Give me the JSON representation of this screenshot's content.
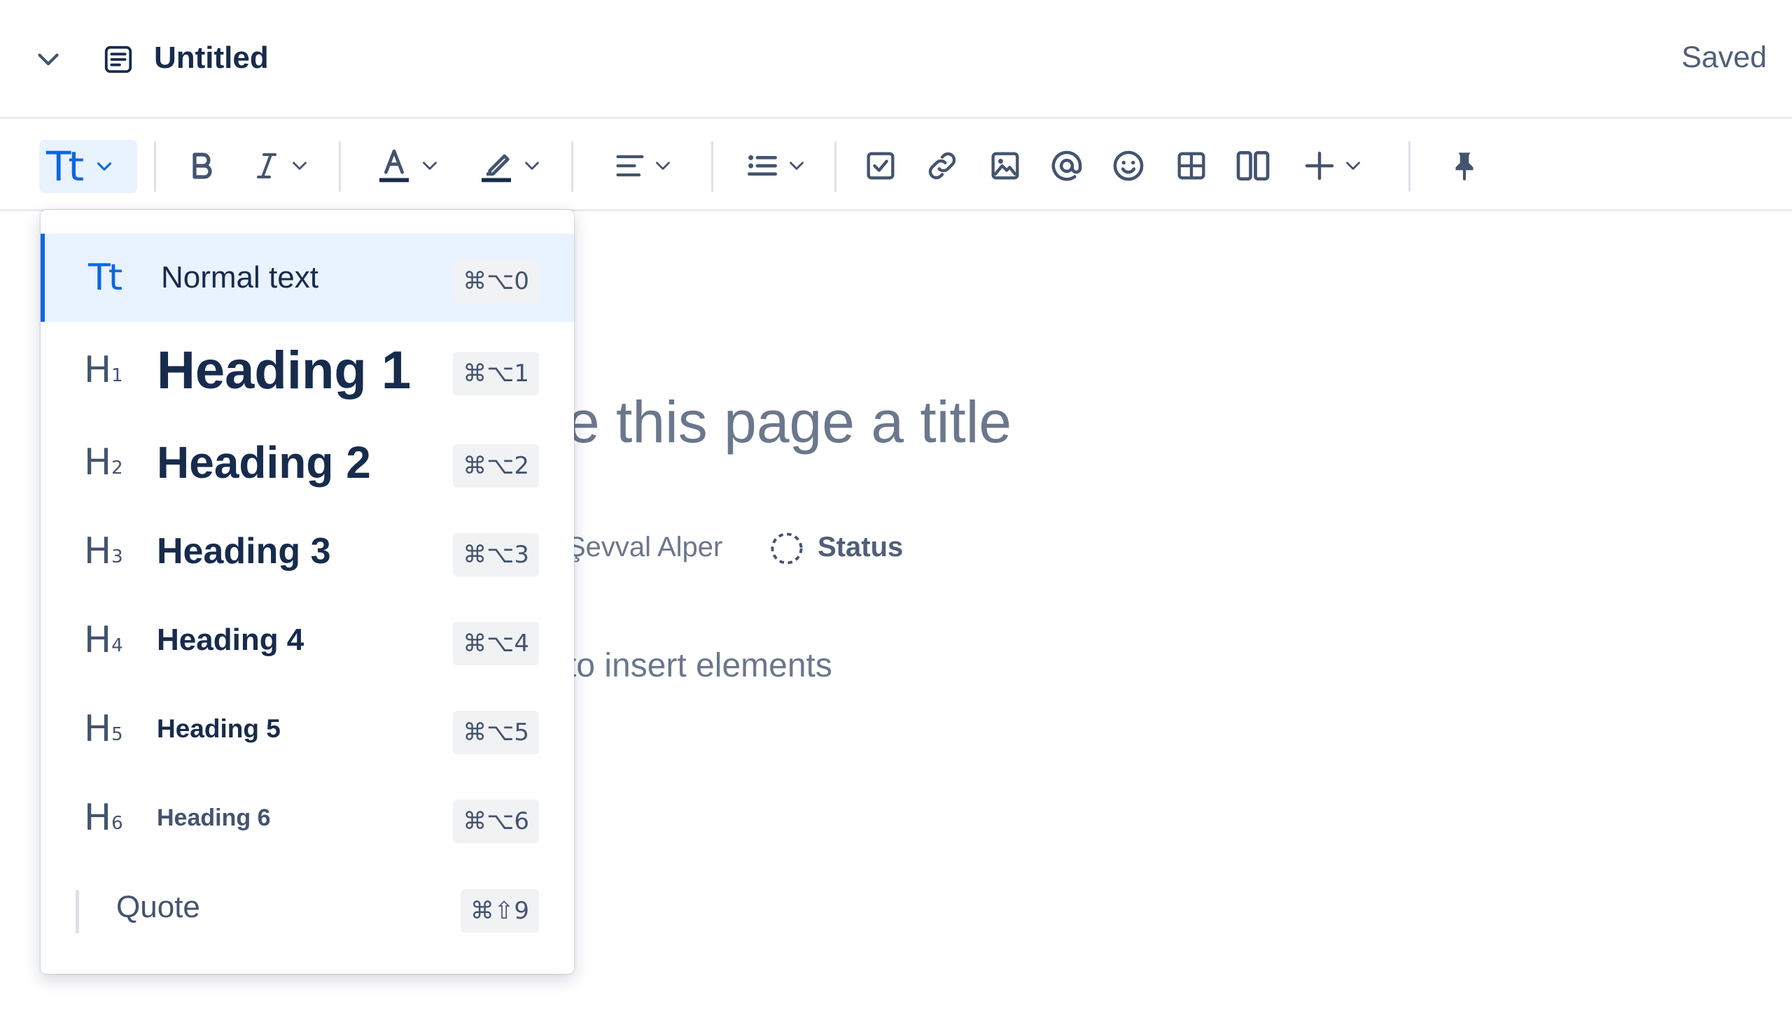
{
  "header": {
    "title": "Untitled",
    "status": "Saved",
    "icons": {
      "collapse": "chevron-down-icon",
      "page": "page-icon"
    }
  },
  "toolbar": {
    "text_style_glyph": "Tt",
    "items": [
      "text-style-dropdown",
      "bold",
      "italic-more",
      "text-color",
      "highlight",
      "alignment",
      "lists",
      "action-item",
      "link",
      "image",
      "mention",
      "emoji",
      "table",
      "layouts",
      "insert-more",
      "pin"
    ],
    "colors": {
      "accent": "#0c66e4",
      "selected_bg": "#e9f2ff"
    }
  },
  "editor": {
    "title_placeholder_fragment": "e this page a title",
    "author_fragment": "Şevval Alper",
    "status_label": "Status",
    "hint_fragment": "to insert elements"
  },
  "dropdown": {
    "items": [
      {
        "icon": "Tt",
        "sub": "",
        "label": "Normal text",
        "shortcut": "⌘⌥0",
        "selected": true
      },
      {
        "icon": "H",
        "sub": "1",
        "label": "Heading 1",
        "shortcut": "⌘⌥1"
      },
      {
        "icon": "H",
        "sub": "2",
        "label": "Heading 2",
        "shortcut": "⌘⌥2"
      },
      {
        "icon": "H",
        "sub": "3",
        "label": "Heading 3",
        "shortcut": "⌘⌥3"
      },
      {
        "icon": "H",
        "sub": "4",
        "label": "Heading 4",
        "shortcut": "⌘⌥4"
      },
      {
        "icon": "H",
        "sub": "5",
        "label": "Heading 5",
        "shortcut": "⌘⌥5"
      },
      {
        "icon": "H",
        "sub": "6",
        "label": "Heading 6",
        "shortcut": "⌘⌥6"
      },
      {
        "icon": "",
        "sub": "",
        "label": "Quote",
        "shortcut": "⌘⇧9"
      }
    ]
  }
}
